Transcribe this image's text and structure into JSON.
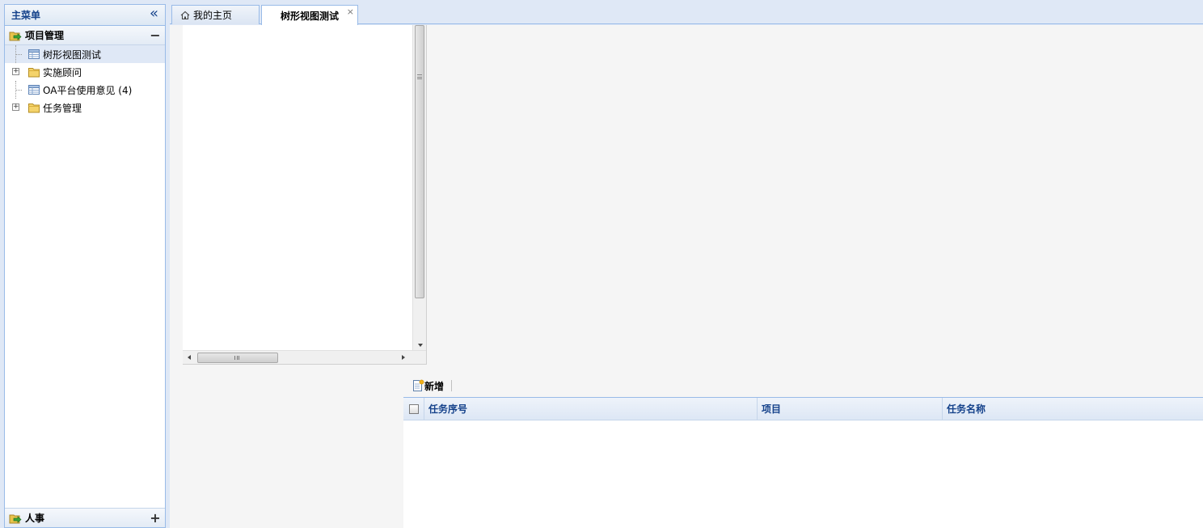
{
  "sidebar": {
    "title": "主菜单",
    "collapse_icon": "double-chevron-left-icon",
    "sections": [
      {
        "label": "项目管理",
        "toggle": "−",
        "items": [
          {
            "label": "树形视图测试",
            "icon": "grid-table-icon",
            "selected": true
          },
          {
            "label": "实施顾问",
            "icon": "folder-icon",
            "expandable": true
          },
          {
            "label": "OA平台使用意见 (4)",
            "icon": "grid-table-icon"
          },
          {
            "label": "任务管理",
            "icon": "folder-icon",
            "expandable": true
          }
        ]
      },
      {
        "label": "人事",
        "toggle": "+"
      }
    ]
  },
  "tabs": [
    {
      "label": "我的主页",
      "icon": "home-icon"
    },
    {
      "label": "树形视图测试",
      "active": true,
      "close": "×"
    }
  ],
  "grid": {
    "toolbar": {
      "add_label": "新增"
    },
    "columns": [
      "任务序号",
      "项目",
      "任务名称"
    ]
  },
  "colors": {
    "accent": "#15428b",
    "border": "#99bbe8",
    "background": "#dfe8f6"
  }
}
